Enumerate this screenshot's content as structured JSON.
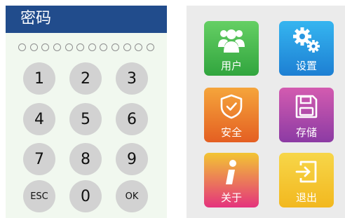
{
  "password_panel": {
    "title": "密码",
    "dot_count": 12,
    "keys": [
      "1",
      "2",
      "3",
      "4",
      "5",
      "6",
      "7",
      "8",
      "9",
      "ESC",
      "0",
      "OK"
    ]
  },
  "menu": {
    "items": [
      {
        "label": "用户",
        "icon": "users-icon"
      },
      {
        "label": "设置",
        "icon": "gears-icon"
      },
      {
        "label": "安全",
        "icon": "shield-check-icon"
      },
      {
        "label": "存储",
        "icon": "floppy-disk-icon"
      },
      {
        "label": "关于",
        "icon": "info-icon"
      },
      {
        "label": "退出",
        "icon": "exit-icon"
      }
    ]
  },
  "colors": {
    "header": "#214c8c",
    "keypad_bg": "#f1f8ef",
    "key": "#d2d2d2",
    "menu_bg": "#ebebeb"
  }
}
